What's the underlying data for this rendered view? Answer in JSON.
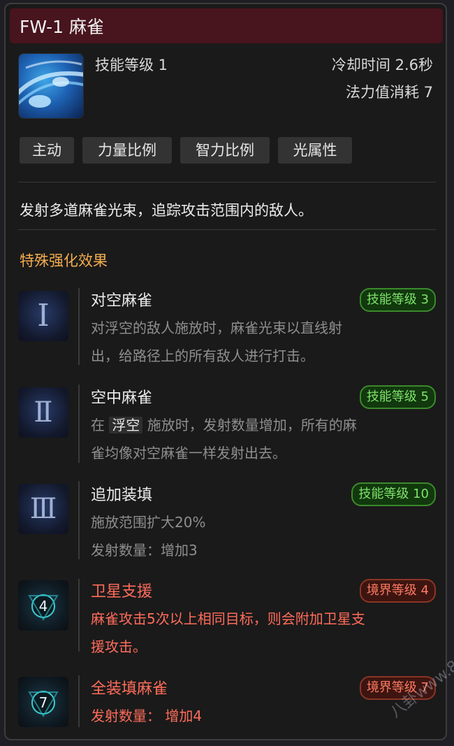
{
  "title": "FW-1 麻雀",
  "skill": {
    "level_label": "技能等级 1",
    "cooldown": "冷却时间 2.6秒",
    "mana_cost": "法力值消耗 7"
  },
  "tags": [
    "主动",
    "力量比例",
    "智力比例",
    "光属性"
  ],
  "description": "发射多道麻雀光束，追踪攻击范围内的敌人。",
  "section_title": "特殊强化效果",
  "enhancements": [
    {
      "icon": "Ⅰ",
      "name": "对空麻雀",
      "badge": "技能等级 3",
      "lines": [
        "对浮空的敌人施放时，麻雀光束以直线射",
        "出，给路径上的所有敌人进行打击。"
      ]
    },
    {
      "icon": "Ⅱ",
      "name": "空中麻雀",
      "badge": "技能等级 5",
      "line1_pre": "在",
      "line1_hl": "浮空",
      "line1_post": "施放时，发射数量增加，所有的麻",
      "line2": "雀均像对空麻雀一样发射出去。"
    },
    {
      "icon": "Ⅲ",
      "name": "追加装填",
      "badge": "技能等级 10",
      "lines": [
        "施放范围扩大20%",
        "发射数量：增加3"
      ]
    },
    {
      "icon": "4",
      "name": "卫星支援",
      "badge": "境界等级 4",
      "lines": [
        "麻雀攻击5次以上相同目标，则会附加卫星支",
        "援攻击。"
      ]
    },
    {
      "icon": "7",
      "name": "全装填麻雀",
      "badge": "境界等级 7",
      "lines": [
        "发射数量： 增加4"
      ]
    }
  ],
  "watermark": "八卦www.8fe.com"
}
